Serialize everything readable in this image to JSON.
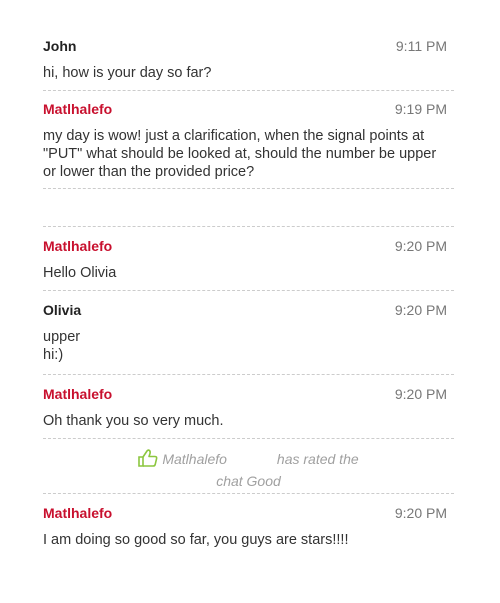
{
  "messages": [
    {
      "sender": "John",
      "time": "9:11 PM",
      "lines": [
        "hi, how is your day so far?"
      ]
    },
    {
      "sender": "Matlhalefo",
      "time": "9:19 PM",
      "lines": [
        "my day is wow! just a clarification, when the signal points at",
        "\"PUT\" what should be looked at, should the number be upper",
        "or lower than the provided price?"
      ]
    },
    {
      "sender": "Matlhalefo",
      "time": "9:20 PM",
      "lines": [
        "Hello Olivia"
      ]
    },
    {
      "sender": "Olivia",
      "time": "9:20 PM",
      "lines": [
        "upper",
        "hi:)"
      ]
    },
    {
      "sender": "Matlhalefo",
      "time": "9:20 PM",
      "lines": [
        "Oh thank you so very much."
      ]
    },
    {
      "sender": "Matlhalefo",
      "time": "9:20 PM",
      "lines": [
        "I am doing so good so far, you guys are stars!!!!"
      ]
    }
  ],
  "rating": {
    "icon": "thumbs-up-icon",
    "name": "Matlhalefo",
    "action": "has rated the",
    "result": "chat Good"
  },
  "colors": {
    "agent_name": "#c8102e",
    "rating_icon": "#8cc63f"
  }
}
